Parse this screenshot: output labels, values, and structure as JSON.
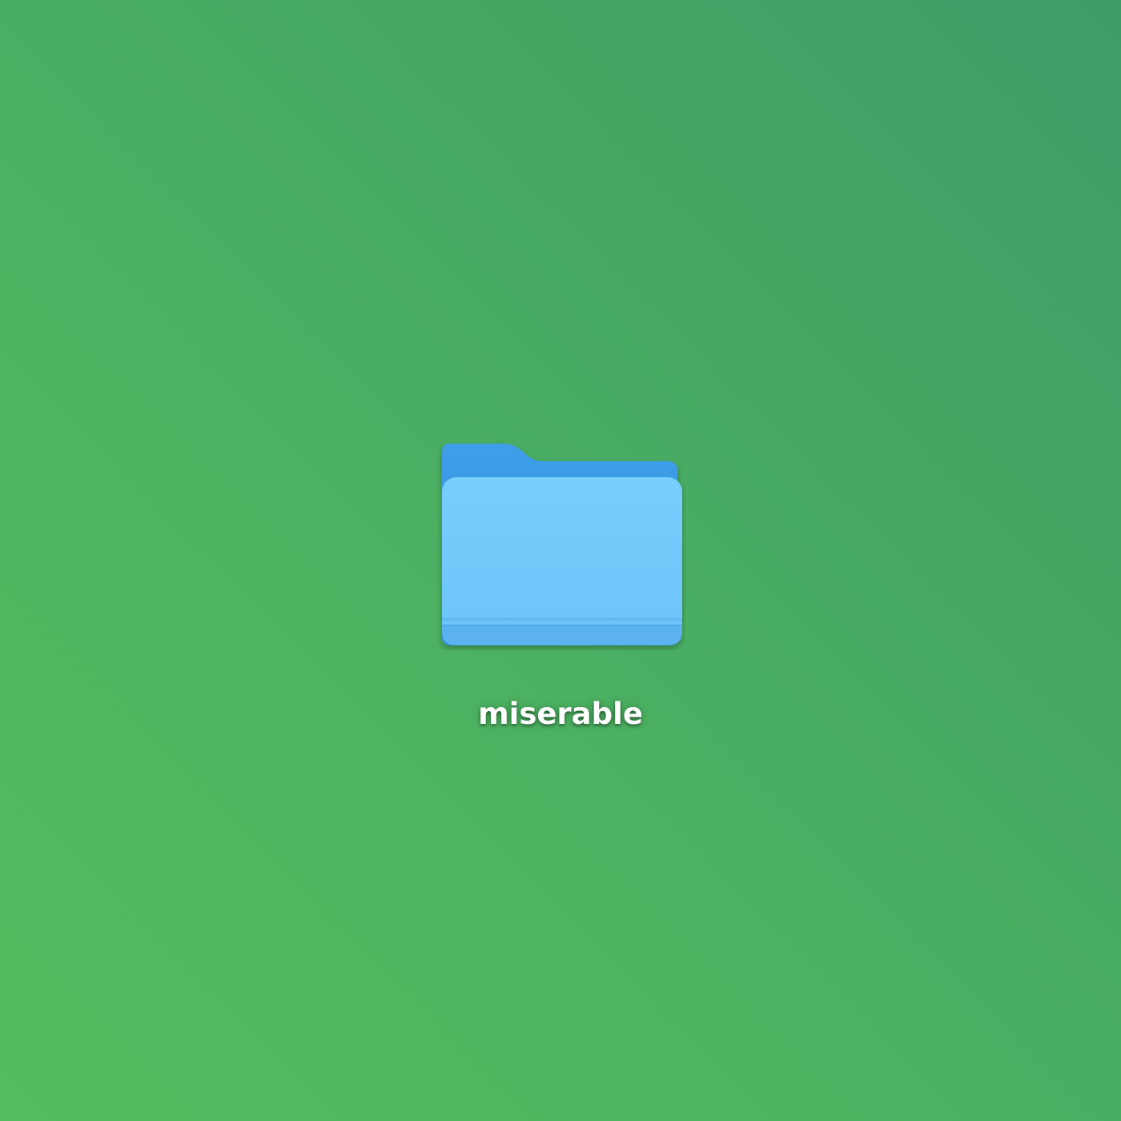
{
  "desktop": {
    "background_colors": [
      "#53be5e",
      "#4bb061",
      "#3f9c67"
    ],
    "items": [
      {
        "label": "miserable",
        "icon": "folder-icon",
        "colors": {
          "back": "#3c9ae6",
          "front_top": "#78cffd",
          "front_bottom": "#6cc3f7",
          "stripe": "#4fa9ec"
        }
      }
    ]
  }
}
